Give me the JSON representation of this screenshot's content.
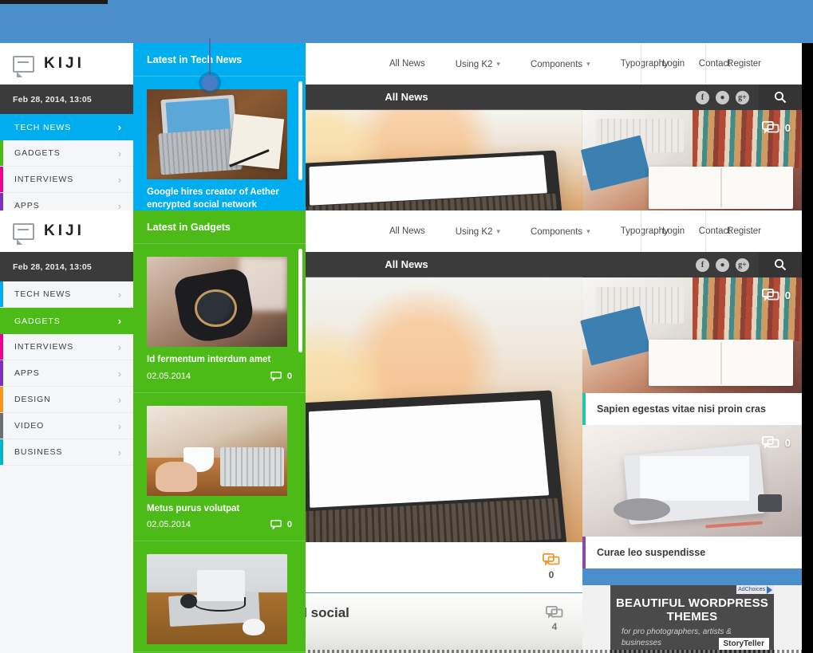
{
  "brand": {
    "name": "KIJI",
    "logo_icon": "speech-bubble-icon"
  },
  "navbar": {
    "links": [
      {
        "label": "All News",
        "caret": ""
      },
      {
        "label": "Using K2",
        "caret": "⌄"
      },
      {
        "label": "Components",
        "caret": "⌄"
      },
      {
        "label": "Typography",
        "caret": ""
      },
      {
        "label": "Contact",
        "caret": ""
      }
    ],
    "auth": [
      {
        "label": "Login"
      },
      {
        "label": "Register"
      }
    ]
  },
  "subheader": {
    "title": "All News",
    "socials": [
      {
        "name": "facebook-icon",
        "glyph": "f"
      },
      {
        "name": "twitter-icon",
        "glyph": "ᴠ"
      },
      {
        "name": "google-plus-icon",
        "glyph": "g+"
      }
    ],
    "search_icon": "search-icon"
  },
  "hero": {
    "side_cards": [
      {
        "comments": "0",
        "caption": "",
        "accent": "#23b7e5"
      },
      {
        "comments": "0",
        "caption": "Sapien egestas vitae nisi proin cras",
        "accent": "#1ec8b0"
      },
      {
        "comments": "0",
        "caption": "Curae leo suspendisse",
        "accent": "#8e44ad"
      }
    ],
    "main_comments": "0",
    "feature": {
      "title": "Google hires creator of Aether encrypted social",
      "comments": "4"
    }
  },
  "ad": {
    "choices_label": "AdChoices",
    "headline": "BEAUTIFUL WORDPRESS THEMES",
    "subline": "for pro photographers, artists & businesses",
    "logo": "StoryTeller"
  },
  "megamenu": {
    "date": "Feb 28, 2014, 13:05",
    "categories": [
      {
        "label": "TECH NEWS",
        "color": "#00aeef"
      },
      {
        "label": "GADGETS",
        "color": "#4cbb17"
      },
      {
        "label": "INTERVIEWS",
        "color": "#ec008c"
      },
      {
        "label": "APPS",
        "color": "#7b2fbe"
      },
      {
        "label": "DESIGN",
        "color": "#f7941e"
      },
      {
        "label": "VIDEO",
        "color": "#6d6e71"
      },
      {
        "label": "BUSINESS",
        "color": "#00b5c8"
      }
    ],
    "chevron_icon": "chevron-right-icon",
    "panels": [
      {
        "active_index": 0,
        "color": "#00aeef",
        "heading": "Latest in Tech News",
        "articles": [
          {
            "title": "Google hires creator of Aether encrypted social network",
            "date": "",
            "comments": "",
            "thumb": "laptop-notebook-desk"
          }
        ]
      },
      {
        "active_index": 1,
        "color": "#4cbb17",
        "heading": "Latest in Gadgets",
        "articles": [
          {
            "title": "Id fermentum interdum amet",
            "date": "02.05.2014",
            "comments": "0",
            "thumb": "wristwatch"
          },
          {
            "title": "Metus purus volutpat",
            "date": "02.05.2014",
            "comments": "0",
            "thumb": "cafe-laptop-cup"
          },
          {
            "title": "",
            "date": "",
            "comments": "",
            "thumb": "desk-mouse-headphones"
          }
        ]
      }
    ]
  }
}
